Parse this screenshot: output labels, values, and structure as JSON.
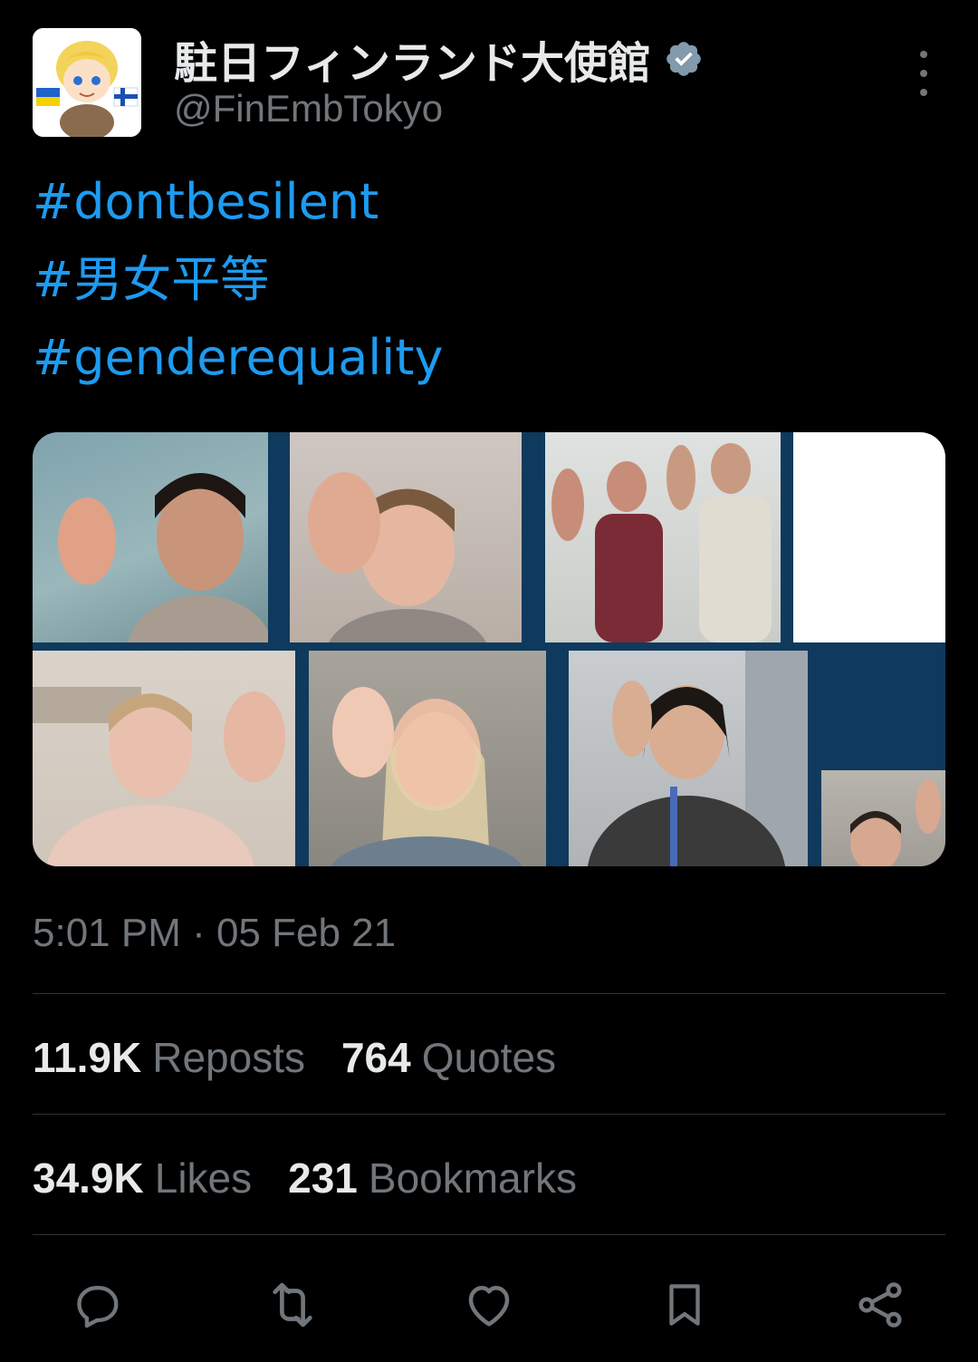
{
  "account": {
    "display_name": "駐日フィンランド大使館",
    "handle": "@FinEmbTokyo",
    "verified_icon": "verified-badge-icon",
    "avatar_icon": "anime-avatar-with-flags"
  },
  "post": {
    "hashtags": [
      "#dontbesilent",
      "#男女平等",
      "#genderequality"
    ],
    "media_label": "video call screenshot grid"
  },
  "meta": {
    "timestamp": "5:01 PM · 05 Feb 21"
  },
  "stats": {
    "reposts_count": "11.9K",
    "reposts_label": "Reposts",
    "quotes_count": "764",
    "quotes_label": "Quotes",
    "likes_count": "34.9K",
    "likes_label": "Likes",
    "bookmarks_count": "231",
    "bookmarks_label": "Bookmarks"
  },
  "actions": [
    "reply-icon",
    "repost-icon",
    "like-icon",
    "bookmark-icon",
    "share-icon"
  ],
  "colors": {
    "background": "#000000",
    "text": "#e7e9ea",
    "secondary": "#71767b",
    "link": "#1d9bf0",
    "verified": "#829aab",
    "divider": "#2f3336"
  }
}
